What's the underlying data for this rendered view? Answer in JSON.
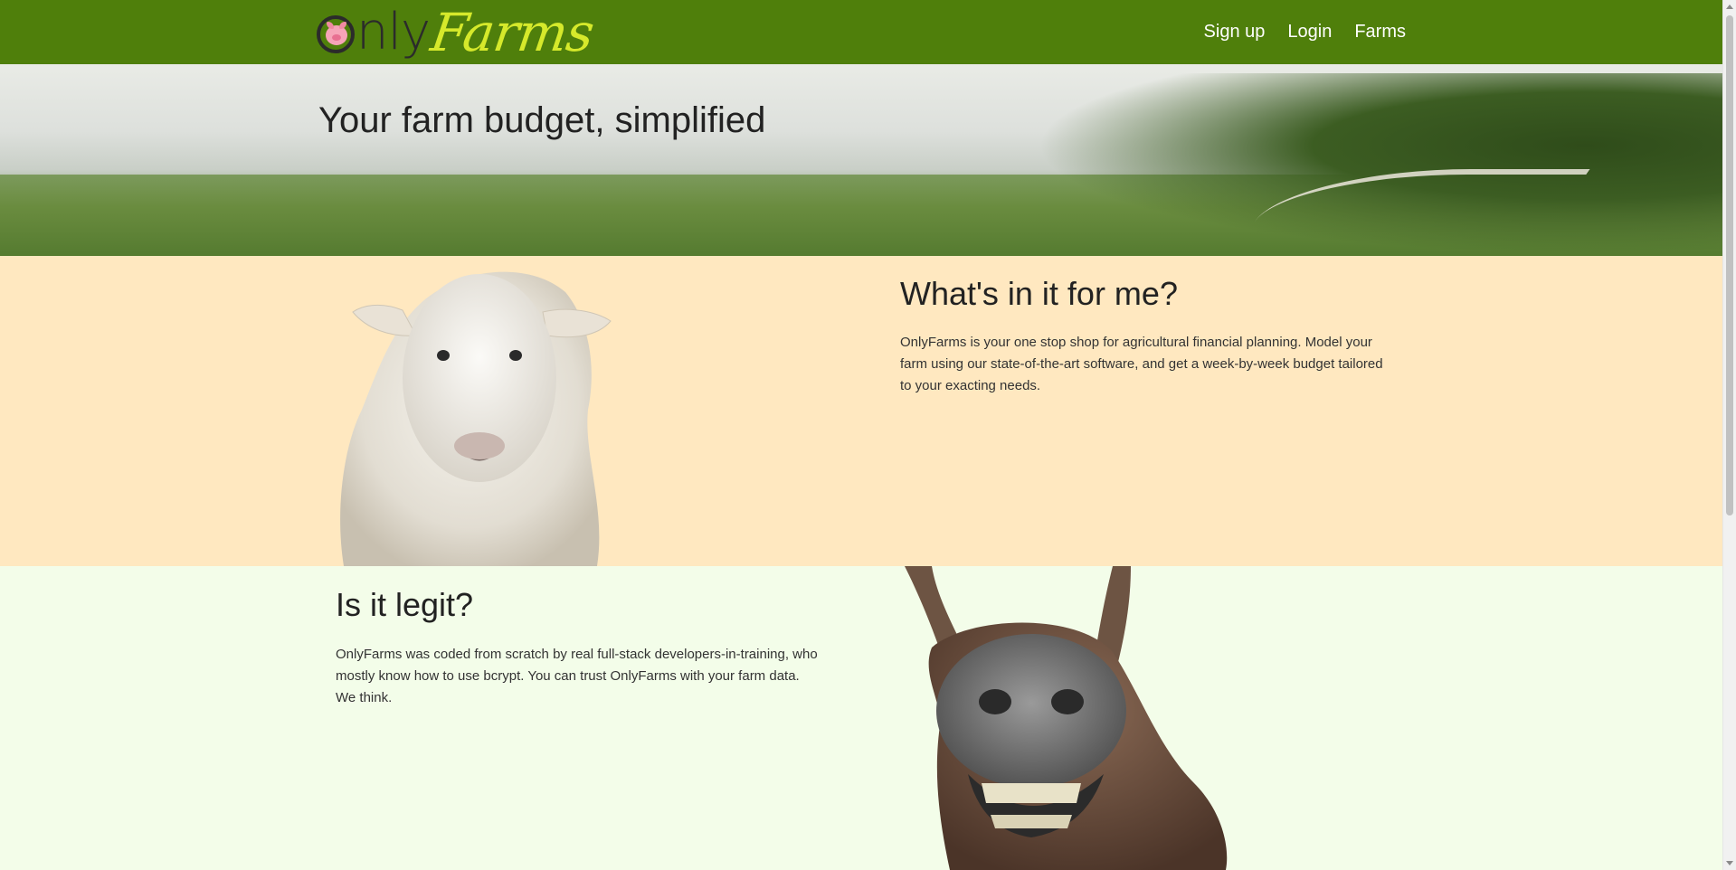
{
  "nav": {
    "brand_only": "Only",
    "brand_farms": "Farms",
    "links": [
      "Sign up",
      "Login",
      "Farms"
    ]
  },
  "hero": {
    "title": "Your farm budget, simplified"
  },
  "section_benefits": {
    "heading": "What's in it for me?",
    "body": "OnlyFarms is your one stop shop for agricultural financial planning. Model your farm using our state-of-the-art software, and get a week-by-week budget tailored to your exacting needs."
  },
  "section_legit": {
    "heading": "Is it legit?",
    "body_line1": "OnlyFarms was coded from scratch by real full-stack developers-in-training, who mostly know how to use bcrypt. You can trust OnlyFarms with your farm data.",
    "body_line2": "We think."
  },
  "colors": {
    "nav_bg": "#4f7f0b",
    "brand_accent": "#d6e92b",
    "section1_bg": "#ffe8c0",
    "section2_bg": "#f3fde9"
  }
}
